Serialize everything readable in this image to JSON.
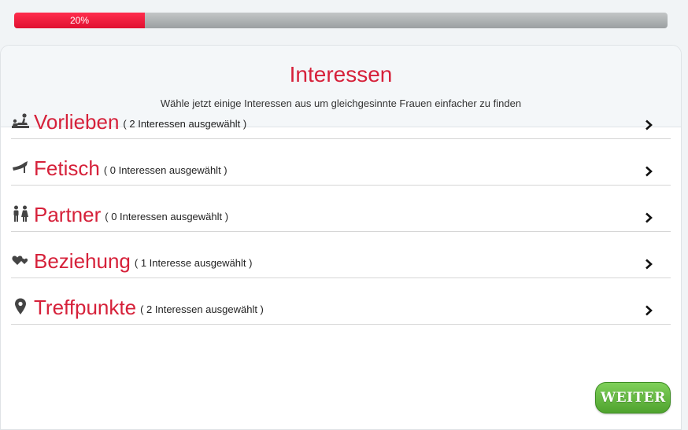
{
  "progress": {
    "value": 0.2,
    "label": "20%"
  },
  "header": {
    "title": "Interessen",
    "subtitle": "Wähle jetzt einige Interessen aus um gleichgesinnte Frauen einfacher zu finden"
  },
  "categories": [
    {
      "label": "Vorlieben",
      "count": "( 2 Interessen ausgewählt )",
      "icon": "couple-position-icon"
    },
    {
      "label": "Fetisch",
      "count": "( 0 Interessen ausgewählt )",
      "icon": "high-heel-icon"
    },
    {
      "label": "Partner",
      "count": "( 0 Interessen ausgewählt )",
      "icon": "people-icon"
    },
    {
      "label": "Beziehung",
      "count": "( 1 Interesse ausgewählt )",
      "icon": "hearts-icon"
    },
    {
      "label": "Treffpunkte",
      "count": "( 2 Interessen ausgewählt )",
      "icon": "map-pin-icon"
    }
  ],
  "button": {
    "label": "WEITER"
  },
  "colors": {
    "accent": "#d6213a",
    "progress": "#f0203f",
    "button": "#5cb338"
  }
}
